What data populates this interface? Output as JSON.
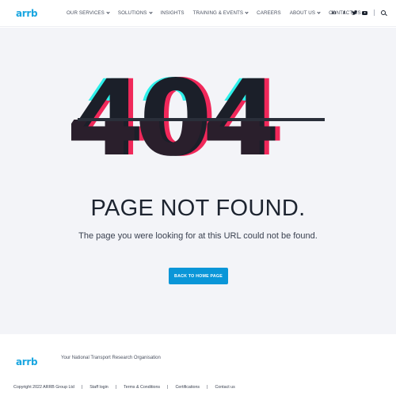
{
  "brand": {
    "logo_text": "arrb",
    "accent": "#1aa6e0",
    "button_color": "#0a96d8"
  },
  "nav": {
    "items": [
      {
        "label": "OUR SERVICES",
        "has_dropdown": true
      },
      {
        "label": "SOLUTIONS",
        "has_dropdown": true
      },
      {
        "label": "INSIGHTS",
        "has_dropdown": false
      },
      {
        "label": "TRAINING & EVENTS",
        "has_dropdown": true
      },
      {
        "label": "CAREERS",
        "has_dropdown": false
      },
      {
        "label": "ABOUT US",
        "has_dropdown": true
      },
      {
        "label": "CONTACT US",
        "has_dropdown": false
      }
    ],
    "social": {
      "linkedin": "in",
      "facebook": "f",
      "twitter": "t"
    }
  },
  "error": {
    "code": "404",
    "title": "PAGE NOT FOUND.",
    "message": "The page you were looking for at this URL could not be found.",
    "button_label": "BACK TO HOME PAGE",
    "glitch_colors": {
      "red": "#f0285a",
      "cyan": "#2ef0ea",
      "dark": "#1b1f29"
    }
  },
  "footer": {
    "logo_text": "arrb",
    "tagline": "Your National Transport Research Organisation",
    "copyright": "Copyright 2022 ARRB Group Ltd",
    "links": [
      "Staff login",
      "Terms & Conditions",
      "Certifications",
      "Contact us"
    ]
  }
}
